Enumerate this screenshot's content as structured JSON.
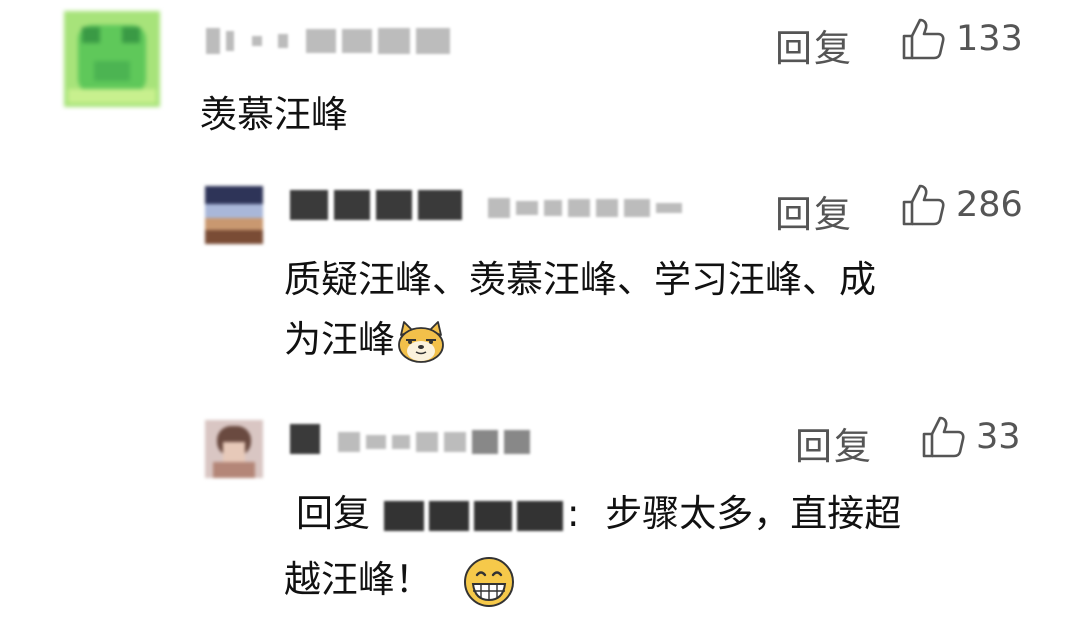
{
  "comments": [
    {
      "level": "top",
      "reply_label": "回复",
      "likes": "133",
      "text": "羡慕汪峰",
      "avatar": "green-frog-avatar (blurred)"
    },
    {
      "level": "reply",
      "reply_label": "回复",
      "likes": "286",
      "text_line1": "质疑汪峰、羡慕汪峰、学习汪峰、成",
      "text_line2": "为汪峰",
      "emoji": "smug-dog-emoji",
      "avatar": "blurred-photo-avatar"
    },
    {
      "level": "reply",
      "reply_label": "回复",
      "likes": "33",
      "prefix": "回复",
      "separator": ":",
      "text_line1": "步骤太多，直接超",
      "text_line2": "越汪峰！",
      "emoji": "grinning-face-emoji",
      "avatar": "blurred-portrait-avatar"
    }
  ],
  "icons": {
    "like": "thumbs-up-outline-icon"
  },
  "colors": {
    "meta_text": "#555555",
    "body_text": "#111111",
    "username_blur": "#3a3a3a"
  }
}
